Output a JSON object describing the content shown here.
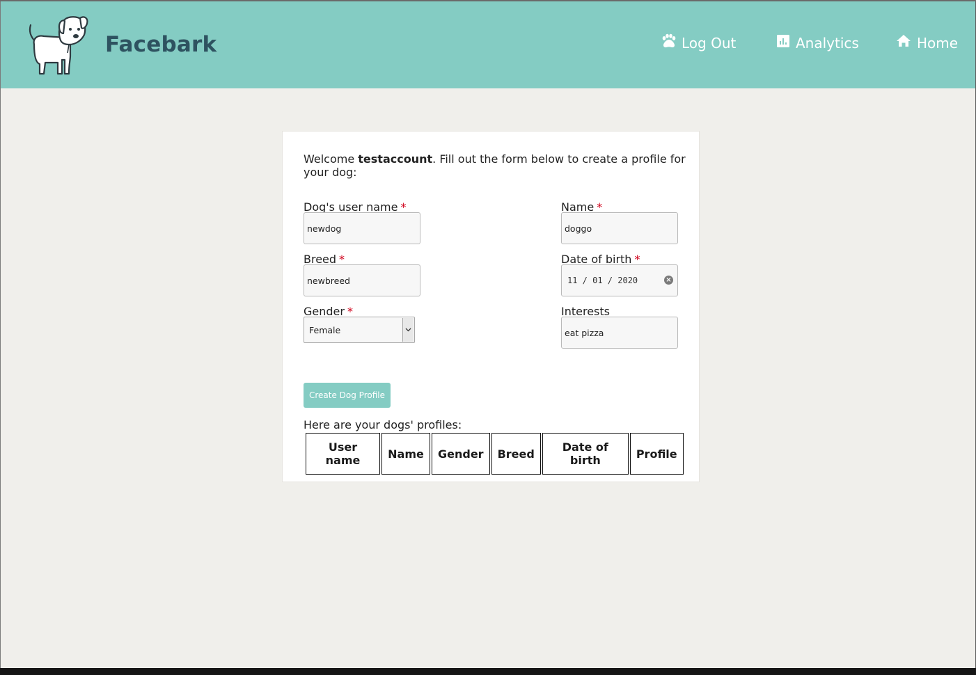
{
  "header": {
    "brand": "Facebark",
    "nav": {
      "logout": "Log Out",
      "analytics": "Analytics",
      "home": "Home"
    },
    "colors": {
      "background": "#84ccc3",
      "brand_text": "#2e5260"
    },
    "icons": {
      "logo": "dog-logo-icon",
      "logout": "paw-icon",
      "analytics": "bar-chart-icon",
      "home": "house-icon"
    }
  },
  "form": {
    "welcome_prefix": "Welcome ",
    "username": "testaccount",
    "welcome_suffix": ". Fill out the form below to create a profile for your dog:",
    "required_marker": "*",
    "fields": {
      "dog_username": {
        "label": "Dog's user name",
        "value": "newdog"
      },
      "name": {
        "label": "Name",
        "value": "doggo"
      },
      "breed": {
        "label": "Breed",
        "value": "newbreed"
      },
      "dob": {
        "label": "Date of birth",
        "value": "11 / 01 / 2020"
      },
      "gender": {
        "label": "Gender",
        "value": "Female"
      },
      "interests": {
        "label": "Interests",
        "value": "eat pizza"
      }
    },
    "submit_label": "Create Dog Profile"
  },
  "profiles": {
    "caption": "Here are your dogs' profiles:",
    "columns": [
      "User name",
      "Name",
      "Gender",
      "Breed",
      "Date of birth",
      "Profile"
    ],
    "rows": []
  }
}
